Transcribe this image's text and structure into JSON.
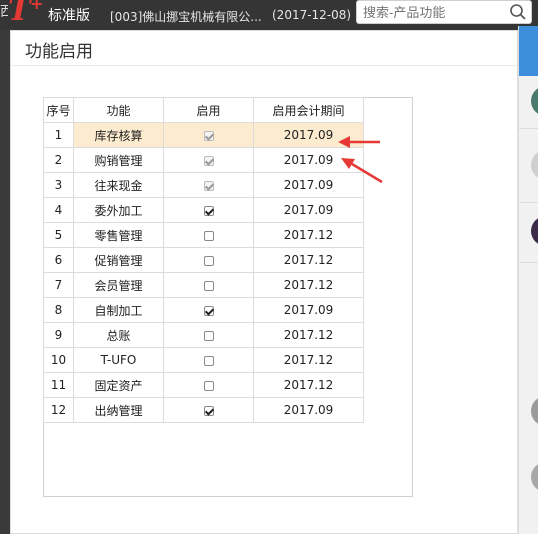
{
  "topbar": {
    "logo_partial": "西",
    "logo_t": "T",
    "logo_plus": "+",
    "edition": "标准版",
    "company": "[003]佛山挪宝机械有限公...",
    "date": "(2017-12-08)",
    "search_placeholder": "搜索-产品功能"
  },
  "dialog": {
    "title": "功能启用"
  },
  "table": {
    "headers": [
      "序号",
      "功能",
      "启用",
      "启用会计期间"
    ],
    "rows": [
      {
        "no": "1",
        "name": "库存核算",
        "enabled": true,
        "disabled": true,
        "period": "2017.09"
      },
      {
        "no": "2",
        "name": "购销管理",
        "enabled": true,
        "disabled": true,
        "period": "2017.09"
      },
      {
        "no": "3",
        "name": "往来现金",
        "enabled": true,
        "disabled": true,
        "period": "2017.09"
      },
      {
        "no": "4",
        "name": "委外加工",
        "enabled": true,
        "disabled": false,
        "period": "2017.09"
      },
      {
        "no": "5",
        "name": "零售管理",
        "enabled": false,
        "disabled": false,
        "period": "2017.12"
      },
      {
        "no": "6",
        "name": "促销管理",
        "enabled": false,
        "disabled": false,
        "period": "2017.12"
      },
      {
        "no": "7",
        "name": "会员管理",
        "enabled": false,
        "disabled": false,
        "period": "2017.12"
      },
      {
        "no": "8",
        "name": "自制加工",
        "enabled": true,
        "disabled": false,
        "period": "2017.09"
      },
      {
        "no": "9",
        "name": "总账",
        "enabled": false,
        "disabled": false,
        "period": "2017.12"
      },
      {
        "no": "10",
        "name": "T-UFO",
        "enabled": false,
        "disabled": false,
        "period": "2017.12"
      },
      {
        "no": "11",
        "name": "固定资产",
        "enabled": false,
        "disabled": false,
        "period": "2017.12"
      },
      {
        "no": "12",
        "name": "出纳管理",
        "enabled": true,
        "disabled": false,
        "period": "2017.09"
      }
    ],
    "highlighted_row": 0
  },
  "colors": {
    "accent": "#3d8fdc",
    "brand": "#e53935",
    "highlight": "#fdebcf",
    "annotation": "#e53935"
  },
  "icons": {
    "search": "search-icon",
    "annotation": "red-arrow-icon"
  }
}
